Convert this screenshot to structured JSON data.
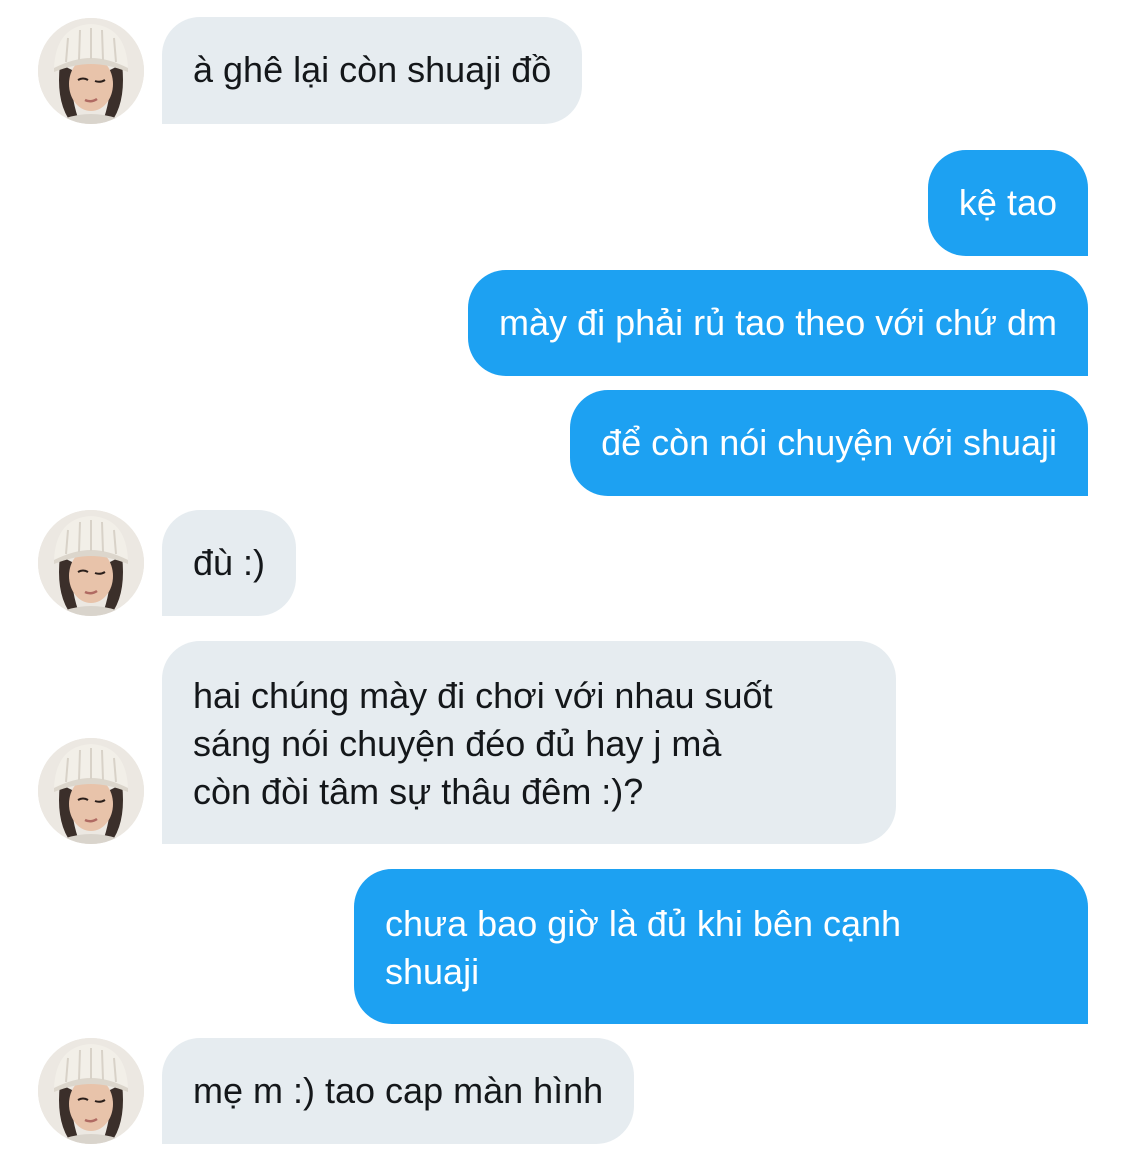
{
  "conversation": {
    "contact": {
      "avatar_icon": "profile-photo-beanie"
    },
    "messages": [
      {
        "side": "incoming",
        "text": "à ghê lại còn shuaji đồ"
      },
      {
        "side": "outgoing",
        "text": "kệ tao"
      },
      {
        "side": "outgoing",
        "text": "mày đi phải rủ tao theo với chứ dm"
      },
      {
        "side": "outgoing",
        "text": "để còn nói chuyện với shuaji"
      },
      {
        "side": "incoming",
        "text": "đù :)"
      },
      {
        "side": "incoming",
        "lines": [
          "hai chúng mày đi chơi với nhau suốt",
          "sáng nói chuyện đéo đủ hay j mà",
          "còn đòi tâm sự thâu đêm :)?"
        ]
      },
      {
        "side": "outgoing",
        "lines": [
          "chưa bao giờ là đủ khi bên cạnh",
          "shuaji"
        ]
      },
      {
        "side": "incoming",
        "text": "mẹ m :) tao cap màn hình"
      }
    ]
  },
  "colors": {
    "incoming_bubble": "#e6ecf0",
    "outgoing_bubble": "#1da1f2",
    "incoming_text": "#14171a",
    "outgoing_text": "#ffffff"
  }
}
